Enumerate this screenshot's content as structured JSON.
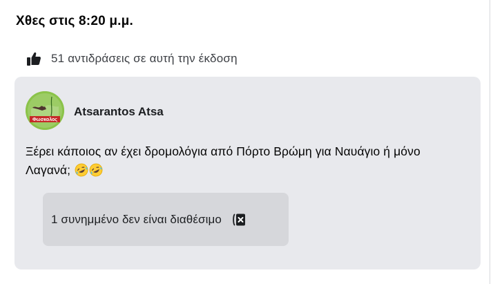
{
  "post": {
    "timestamp": "Χθες στις 8:20 μ.μ.",
    "reactions_text": "51 αντιδράσεις σε αυτή την έκδοση",
    "author": "Atsarantos Atsa",
    "text": "Ξέρει κάποιος αν έχει δρομολόγια από Πόρτο Βρώμη για Ναυάγιο ή μόνο Λαγανά;",
    "emojis": [
      "rolling-on-floor-laughing-emoji",
      "rolling-on-floor-laughing-emoji"
    ],
    "attachment": {
      "label": "1 συνημμένο δεν είναι διαθέσιμο",
      "icon": "unavailable-attachment-icon"
    },
    "avatar": {
      "icon": "avatar",
      "caption": "Φωσκολος",
      "colors": {
        "main": "#8bc34a",
        "banner": "#c62828"
      }
    }
  },
  "colors": {
    "card_background": "#e8e9ed",
    "attachment_background": "#d6d7db",
    "text_primary": "#050505",
    "text_secondary": "#3c3f44"
  }
}
